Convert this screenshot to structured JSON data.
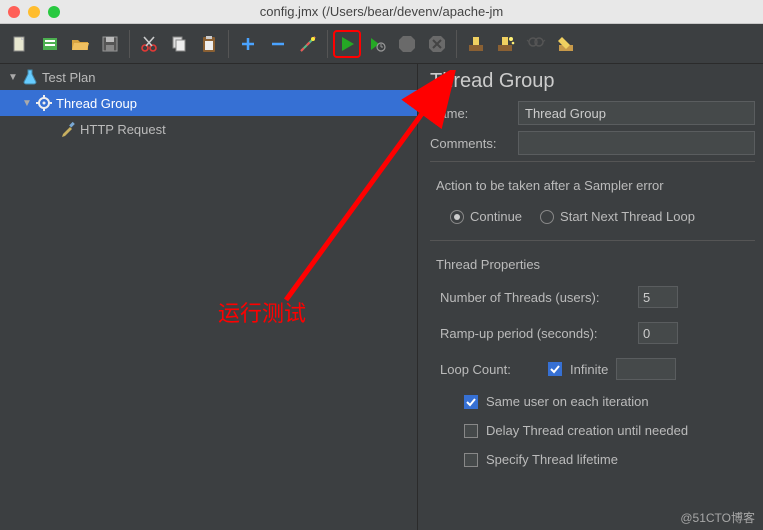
{
  "window": {
    "title": "config.jmx (/Users/bear/devenv/apache-jm"
  },
  "tree": {
    "items": [
      {
        "label": "Test Plan"
      },
      {
        "label": "Thread Group"
      },
      {
        "label": "HTTP Request"
      }
    ]
  },
  "panel": {
    "heading": "Thread Group",
    "name_label": "Name:",
    "name_value": "Thread Group",
    "comments_label": "Comments:",
    "comments_value": "",
    "action_label": "Action to be taken after a Sampler error",
    "radios": {
      "continue": "Continue",
      "next_loop": "Start Next Thread Loop"
    },
    "props_heading": "Thread Properties",
    "threads_label": "Number of Threads (users):",
    "threads_value": "5",
    "rampup_label": "Ramp-up period (seconds):",
    "rampup_value": "0",
    "loop_label": "Loop Count:",
    "loop_infinite": "Infinite",
    "loop_value": "",
    "same_user": "Same user on each iteration",
    "delay_create": "Delay Thread creation until needed",
    "spec_lifetime": "Specify Thread lifetime"
  },
  "annotation": {
    "text": "运行测试"
  },
  "watermark": "@51CTO博客",
  "icons": {
    "new": "new-file-icon",
    "templates": "templates-icon",
    "open": "open-icon",
    "save": "save-icon",
    "cut": "cut-icon",
    "copy": "copy-icon",
    "paste": "paste-icon",
    "plus": "plus-icon",
    "minus": "minus-icon",
    "wand": "wand-icon",
    "run": "run-icon",
    "run_no_pause": "run-no-pause-icon",
    "stop": "stop-icon",
    "shutdown": "shutdown-icon",
    "clear": "clear-icon",
    "clear_all": "clear-all-icon",
    "search": "search-icon",
    "reset": "reset-icon"
  }
}
